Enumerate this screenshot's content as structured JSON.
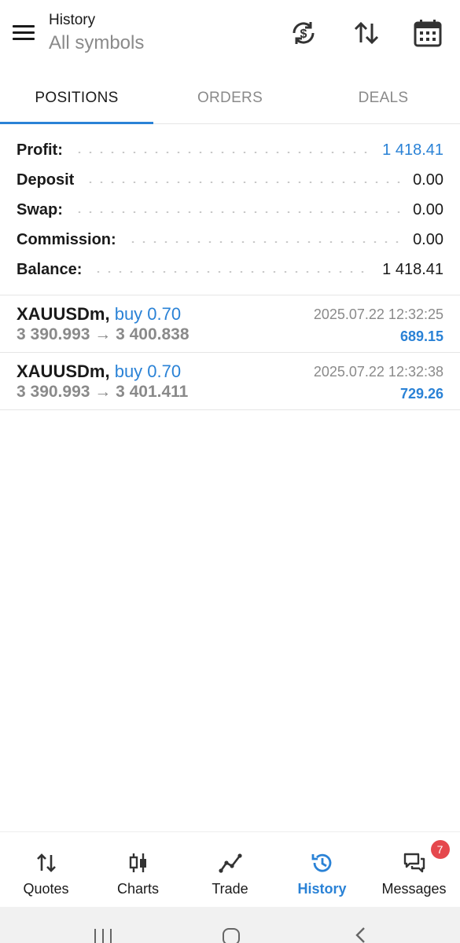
{
  "header": {
    "title": "History",
    "subtitle": "All symbols",
    "icons": [
      "currency-sync-icon",
      "sort-arrows-icon",
      "calendar-icon"
    ]
  },
  "tabs": [
    {
      "label": "POSITIONS",
      "active": true
    },
    {
      "label": "ORDERS",
      "active": false
    },
    {
      "label": "DEALS",
      "active": false
    }
  ],
  "summary": [
    {
      "label": "Profit:",
      "value": "1 418.41",
      "highlight": true
    },
    {
      "label": "Deposit",
      "value": "0.00",
      "highlight": false
    },
    {
      "label": "Swap:",
      "value": "0.00",
      "highlight": false
    },
    {
      "label": "Commission:",
      "value": "0.00",
      "highlight": false
    },
    {
      "label": "Balance:",
      "value": "1 418.41",
      "highlight": false
    }
  ],
  "positions": [
    {
      "symbol": "XAUUSDm,",
      "side": "buy 0.70",
      "prices": "3 390.993 → 3 400.838",
      "time": "2025.07.22 12:32:25",
      "profit": "689.15"
    },
    {
      "symbol": "XAUUSDm,",
      "side": "buy 0.70",
      "prices": "3 390.993 → 3 401.411",
      "time": "2025.07.22 12:32:38",
      "profit": "729.26"
    }
  ],
  "nav": [
    {
      "label": "Quotes",
      "icon": "quotes-arrows-icon",
      "active": false
    },
    {
      "label": "Charts",
      "icon": "candlestick-icon",
      "active": false
    },
    {
      "label": "Trade",
      "icon": "trend-line-icon",
      "active": false
    },
    {
      "label": "History",
      "icon": "history-clock-icon",
      "active": true
    },
    {
      "label": "Messages",
      "icon": "chat-bubbles-icon",
      "active": false,
      "badge": "7"
    }
  ],
  "colors": {
    "accent": "#2a82d6",
    "muted": "#8a8a8a",
    "badge": "#e5484d"
  }
}
